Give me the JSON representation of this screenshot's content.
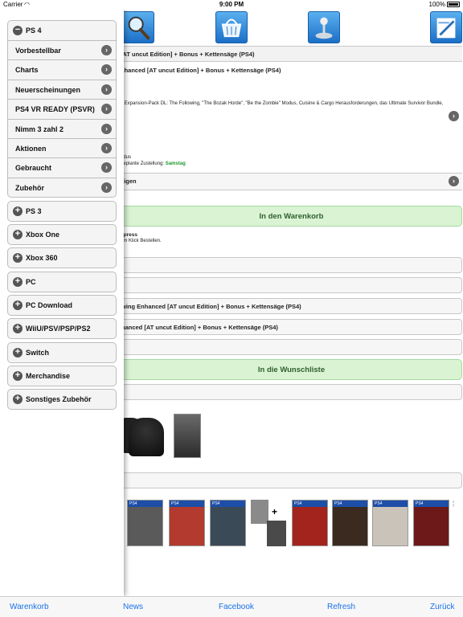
{
  "status": {
    "carrier": "Carrier",
    "time": "9:00 PM",
    "battery": "100%"
  },
  "toolbar_icons": [
    "search-icon",
    "basket-icon",
    "joystick-icon",
    "edit-icon"
  ],
  "product": {
    "title_row": "[AT uncut Edition] + Bonus + Kettensäge (PS4)",
    "subtitle": "nhanced [AT uncut Edition] + Bonus + Kettensäge (PS4)",
    "desc": "s Expansion-Pack DL: The Following, \"The Bozak Horde\", \"Be the Zombie\" Modus, Cuisine & Cargo Herausforderungen, das Ultimate Survivor Bundle,",
    "modus": "odus",
    "delivery_label": "geplante Zustellung:",
    "delivery_day": "Samstag",
    "show_row": "eigen",
    "cart_button": "In den Warenkorb",
    "express": "xpress",
    "express_desc": "em Klick Bestellen.",
    "box_row_3": "wing Enhanced [AT uncut Edition] + Bonus + Kettensäge (PS4)",
    "box_row_4": "hanced [AT uncut Edition] + Bonus + Kettensäge (PS4)",
    "wishlist_button": "In die Wunschliste"
  },
  "thumbs": [
    {
      "label": "PS4",
      "color": "#5a5a5a"
    },
    {
      "label": "PS4",
      "color": "#b23a2e"
    },
    {
      "label": "PS4",
      "color": "#3b4a57"
    },
    {
      "label": "",
      "color": "#8a8a8a"
    },
    {
      "label": "PS4",
      "color": "#a3231d"
    },
    {
      "label": "PS4",
      "color": "#3a2a20"
    },
    {
      "label": "PS4",
      "color": "#c9c3ba"
    },
    {
      "label": "PS4",
      "color": "#6d1919"
    }
  ],
  "drawer": {
    "open_group": "PS 4",
    "sub_items": [
      "Vorbestellbar",
      "Charts",
      "Neuerscheinungen",
      "PS4 VR READY (PSVR)",
      "Nimm 3 zahl 2",
      "Aktionen",
      "Gebraucht",
      "Zubehör"
    ],
    "groups": [
      "PS 3",
      "Xbox One",
      "Xbox 360",
      "PC",
      "PC Download",
      "WiiU/PSV/PSP/PS2",
      "Switch",
      "Merchandise",
      "Sonstiges Zubehör"
    ]
  },
  "tabbar": {
    "cart": "Warenkorb",
    "news": "News",
    "facebook": "Facebook",
    "refresh": "Refresh",
    "back": "Zurück"
  }
}
